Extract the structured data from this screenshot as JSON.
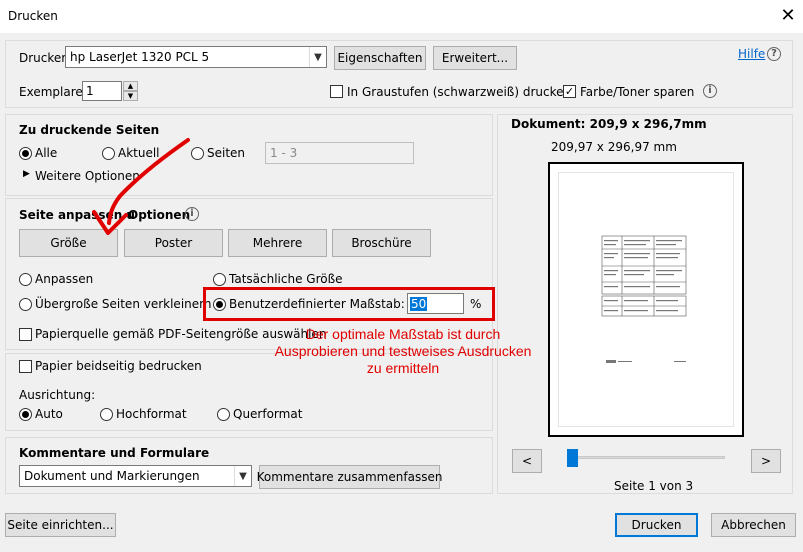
{
  "window": {
    "title": "Drucken",
    "close": "✕"
  },
  "printer": {
    "label": "Drucker:",
    "selected": "hp LaserJet 1320 PCL 5",
    "properties": "Eigenschaften",
    "advanced": "Erweitert...",
    "help": "Hilfe",
    "help_icon": "?"
  },
  "copies": {
    "label": "Exemplare:",
    "value": "1"
  },
  "options": {
    "grayscale": "In Graustufen (schwarzweiß) drucken",
    "grayscale_checked": false,
    "save_toner": "Farbe/Toner sparen",
    "save_toner_checked": true
  },
  "pages": {
    "heading": "Zu druckende Seiten",
    "all": "Alle",
    "current": "Aktuell",
    "pages": "Seiten",
    "range_placeholder": "1 - 3",
    "more": "Weitere Optionen"
  },
  "sizing": {
    "heading_left": "Seite anpassen u",
    "heading_right": "Optionen",
    "tabs": [
      "Größe",
      "Poster",
      "Mehrere",
      "Broschüre"
    ],
    "fit": "Anpassen",
    "actual": "Tatsächliche Größe",
    "shrink": "Übergroße Seiten verkleinern",
    "custom": "Benutzerdefinierter Maßstab:",
    "custom_value": "50",
    "percent": "%",
    "paper_source": "Papierquelle gemäß PDF-Seitengröße auswählen"
  },
  "duplex": {
    "label": "Papier beidseitig bedrucken"
  },
  "orientation": {
    "label": "Ausrichtung:",
    "auto": "Auto",
    "portrait": "Hochformat",
    "landscape": "Querformat"
  },
  "comments": {
    "heading": "Kommentare und Formulare",
    "selected": "Dokument und Markierungen",
    "summarize": "Kommentare zusammenfassen"
  },
  "preview": {
    "doc_size": "Dokument: 209,9 x 296,7mm",
    "page_size": "209,97 x 296,97 mm",
    "prev": "<",
    "next": ">",
    "page_info": "Seite 1 von 3"
  },
  "footer": {
    "page_setup": "Seite einrichten...",
    "print": "Drucken",
    "cancel": "Abbrechen"
  },
  "annotation": {
    "line1": "Der optimale Maßstab ist durch",
    "line2": "Ausprobieren und testweises Ausdrucken",
    "line3": "zu ermitteln",
    "color": "#e10000"
  },
  "info_icon": "i"
}
